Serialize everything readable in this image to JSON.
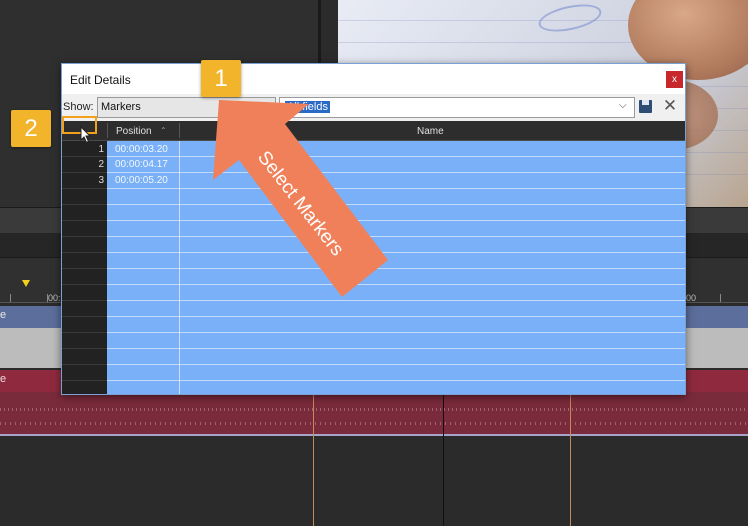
{
  "dialog": {
    "title": "Edit Details",
    "close_glyph": "x",
    "show_label": "Show:",
    "show_value": "Markers",
    "fields_value": "All fields",
    "dropdown_glyph": "⌵",
    "delete_glyph": "✕",
    "columns": [
      "Position",
      "Name"
    ],
    "sort_glyph": "⌃",
    "rows": [
      {
        "num": "1",
        "position": "00:00:03.20",
        "name": ""
      },
      {
        "num": "2",
        "position": "00:00:04.17",
        "name": ""
      },
      {
        "num": "3",
        "position": "00:00:05.20",
        "name": ""
      }
    ]
  },
  "callouts": {
    "badge1": "1",
    "badge2": "2",
    "arrow_text": "Select Markers",
    "arrow_color": "#f0805a",
    "badge_color": "#f2b42a"
  },
  "timeline": {
    "ruler_label_1": "00:",
    "ruler_label_2": "00",
    "track1_name": "e",
    "track2_name": "e"
  },
  "icons": {
    "save": "save-icon",
    "delete": "delete-icon",
    "cursor": "mouse-cursor-icon"
  }
}
